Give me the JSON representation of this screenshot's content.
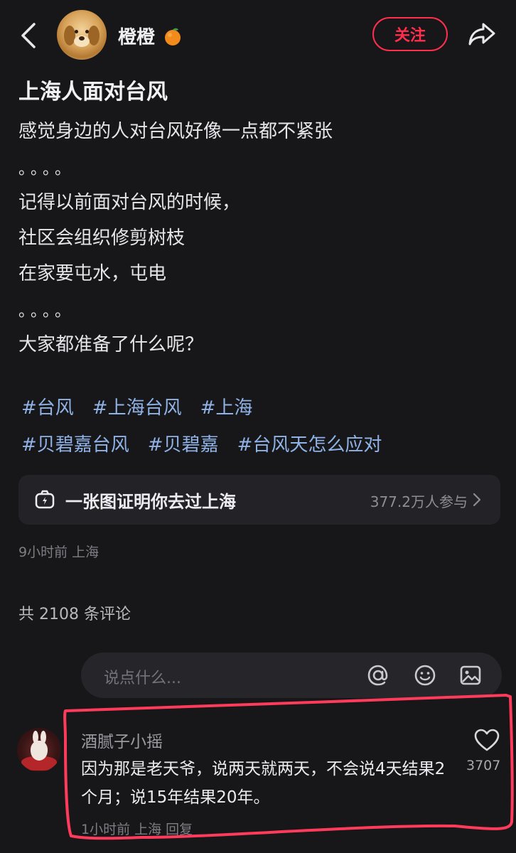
{
  "header": {
    "username": "橙橙",
    "follow_label": "关注"
  },
  "post": {
    "title": "上海人面对台风",
    "lines": [
      "感觉身边的人对台风好像一点都不紧张",
      "。。。。",
      "记得以前面对台风的时候，",
      "社区会组织修剪树枝",
      "在家要屯水，屯电",
      "。。。。",
      "大家都准备了什么呢？"
    ],
    "tags_row1": [
      "#台风",
      "#上海台风",
      "#上海"
    ],
    "tags_row2": [
      "#贝碧嘉台风",
      "#贝碧嘉",
      "#台风天怎么应对"
    ],
    "topic": {
      "label": "一张图证明你去过上海",
      "participants": "377.2万人参与"
    },
    "meta": "9小时前 上海"
  },
  "comments_section": {
    "count_text": "共 2108 条评论",
    "input_placeholder": "说点什么..."
  },
  "comment": {
    "author": "酒腻子小摇",
    "text": "因为那是老天爷，说两天就两天，不会说4天结果2个月；说15年结果20年。",
    "meta": "1小时前 上海 回复",
    "likes": "3707"
  },
  "colors": {
    "background": "#17171a",
    "accent_red": "#ff2e4d",
    "tag_blue": "#8fb3e6",
    "highlight_red": "#ff3b5c"
  }
}
